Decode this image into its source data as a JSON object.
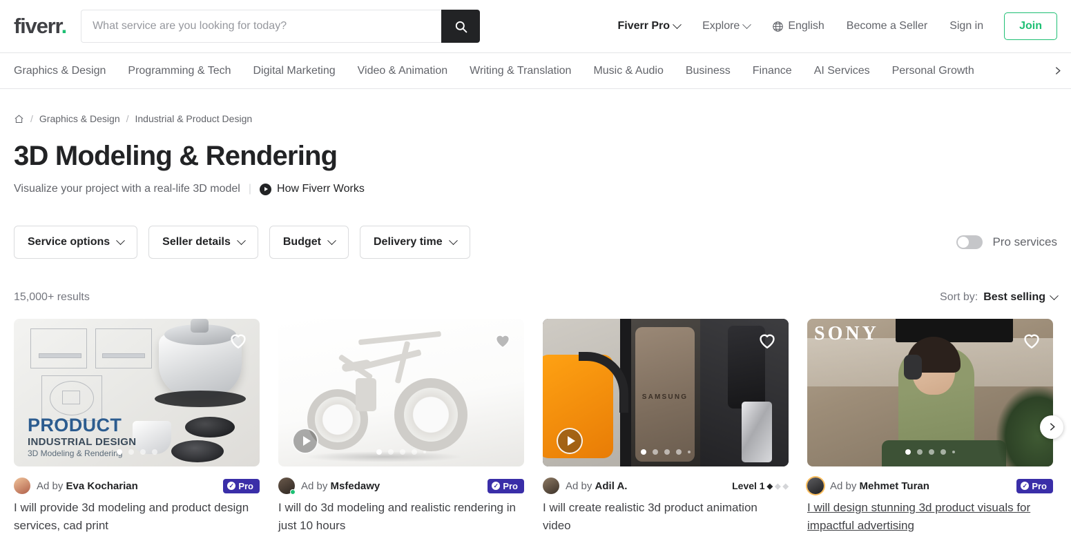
{
  "header": {
    "logo_text": "fiverr",
    "logo_dot": ".",
    "search_placeholder": "What service are you looking for today?",
    "search_value": "",
    "search_icon": "search-icon",
    "nav": [
      {
        "label": "Fiverr Pro",
        "caret": true,
        "strong": true
      },
      {
        "label": "Explore",
        "caret": true,
        "strong": false
      },
      {
        "label": "English",
        "caret": false,
        "strong": false,
        "icon": "globe-icon"
      },
      {
        "label": "Become a Seller",
        "caret": false,
        "strong": false
      },
      {
        "label": "Sign in",
        "caret": false,
        "strong": false
      }
    ],
    "join_label": "Join",
    "join_color": "#1dbf73"
  },
  "categories": [
    "Graphics & Design",
    "Programming & Tech",
    "Digital Marketing",
    "Video & Animation",
    "Writing & Translation",
    "Music & Audio",
    "Business",
    "Finance",
    "AI Services",
    "Personal Growth"
  ],
  "breadcrumb": {
    "home_icon": "home-icon",
    "items": [
      "Graphics & Design",
      "Industrial & Product Design"
    ],
    "separator": "/"
  },
  "page": {
    "title": "3D Modeling & Rendering",
    "subtitle": "Visualize your project with a real-life 3D model",
    "divider": "|",
    "how_it_works": "How Fiverr Works"
  },
  "filters": {
    "buttons": [
      "Service options",
      "Seller details",
      "Budget",
      "Delivery time"
    ],
    "pro_services_label": "Pro services",
    "pro_services_on": false
  },
  "results": {
    "count_label": "15,000+ results",
    "sort_label": "Sort by:",
    "sort_value": "Best selling"
  },
  "cards": [
    {
      "seller": "Eva Kocharian",
      "ad_prefix": "Ad by",
      "title": "I will provide 3d modeling and product design services, cad print",
      "badge_type": "pro",
      "badge_label": "Pro",
      "has_play": false,
      "has_online": false,
      "dots_total": 4,
      "dots_active": 0,
      "has_tiny_dot": false,
      "underlined": false,
      "avatar_ring": false,
      "overlay_text": {
        "line1": "PRODUCT",
        "line2": "INDUSTRIAL DESIGN",
        "line3": "3D Modeling & Rendering"
      }
    },
    {
      "seller": "Msfedawy",
      "ad_prefix": "Ad by",
      "title": "I will do 3d modeling and realistic rendering in just 10 hours",
      "badge_type": "pro",
      "badge_label": "Pro",
      "has_play": true,
      "has_online": true,
      "dots_total": 4,
      "dots_active": 0,
      "has_tiny_dot": true,
      "underlined": false,
      "avatar_ring": false
    },
    {
      "seller": "Adil A.",
      "ad_prefix": "Ad by",
      "title": "I will create realistic 3d product animation video",
      "badge_type": "level",
      "badge_label": "Level 1",
      "level_filled": 1,
      "level_total": 3,
      "has_play": true,
      "has_online": false,
      "dots_total": 4,
      "dots_active": 0,
      "has_tiny_dot": true,
      "underlined": false,
      "avatar_ring": false,
      "overlay_text": {
        "brand": "SAMSUNG"
      }
    },
    {
      "seller": "Mehmet Turan",
      "ad_prefix": "Ad by",
      "title": "I will design stunning 3d product visuals for impactful advertising",
      "badge_type": "pro",
      "badge_label": "Pro",
      "has_play": false,
      "has_online": false,
      "dots_total": 4,
      "dots_active": 0,
      "has_tiny_dot": true,
      "underlined": true,
      "avatar_ring": true,
      "has_next_arrow": true,
      "overlay_text": {
        "brand": "SONY"
      }
    }
  ]
}
